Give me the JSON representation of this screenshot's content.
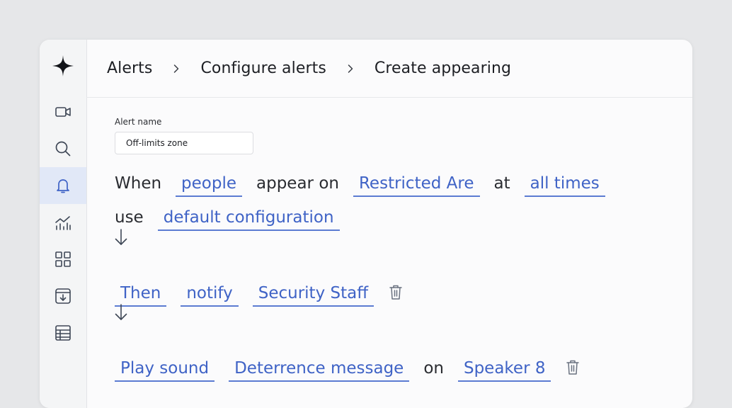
{
  "breadcrumb": {
    "items": [
      "Alerts",
      "Configure alerts",
      "Create appearing"
    ]
  },
  "sidebar": {
    "logo": "sparkle-logo",
    "items": [
      {
        "icon": "video-camera-icon",
        "active": false
      },
      {
        "icon": "search-icon",
        "active": false
      },
      {
        "icon": "bell-icon",
        "active": true
      },
      {
        "icon": "analytics-chart-icon",
        "active": false
      },
      {
        "icon": "grid-icon",
        "active": false
      },
      {
        "icon": "archive-download-icon",
        "active": false
      },
      {
        "icon": "table-icon",
        "active": false
      }
    ]
  },
  "form": {
    "alert_name_label": "Alert name",
    "alert_name_value": "Off-limits zone"
  },
  "rule": {
    "when": "When",
    "subject": "people",
    "appear_on": "appear on",
    "zone": "Restricted Are",
    "at": "at",
    "time": "all times",
    "use": "use",
    "config": "default configuration"
  },
  "action1": {
    "then": "Then",
    "verb": "notify",
    "target": "Security Staff"
  },
  "action2": {
    "action": "Play sound",
    "message": "Deterrence message",
    "on": "on",
    "device": "Speaker 8"
  },
  "colors": {
    "accent": "#3f63c6",
    "active_nav_bg": "#e1e8f7",
    "icon": "#3e4756"
  }
}
